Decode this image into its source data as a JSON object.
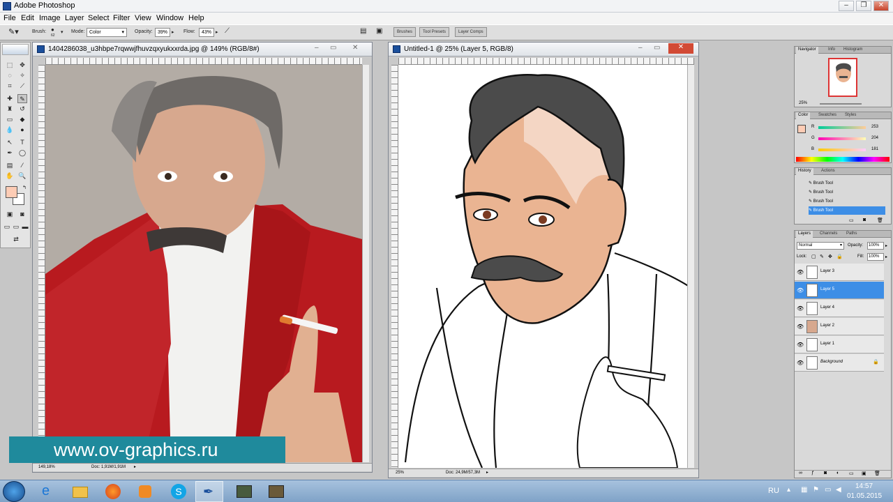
{
  "app": {
    "title": "Adobe Photoshop"
  },
  "menu": [
    "File",
    "Edit",
    "Image",
    "Layer",
    "Select",
    "Filter",
    "View",
    "Window",
    "Help"
  ],
  "options": {
    "brush_label": "Brush:",
    "brush_size": "62",
    "mode_label": "Mode:",
    "mode_value": "Color",
    "opacity_label": "Opacity:",
    "opacity_value": "39%",
    "flow_label": "Flow:",
    "flow_value": "43%",
    "well_tabs": [
      "Brushes",
      "Tool Presets",
      "Layer Comps"
    ]
  },
  "doc1": {
    "title": "1404286038_u3hbpe7rqwwjfhuvzqxyukxxrda.jpg @ 149% (RGB/8#)",
    "zoom": "149,18%",
    "doc_size": "Doc: 1,91M/1,91M"
  },
  "doc2": {
    "title": "Untitled-1 @ 25% (Layer 5, RGB/8)",
    "zoom": "25%",
    "doc_size": "Doc: 24,9M/57,3M"
  },
  "navigator": {
    "tabs": [
      "Navigator",
      "Info",
      "Histogram"
    ],
    "zoom": "25%"
  },
  "color": {
    "tabs": [
      "Color",
      "Swatches",
      "Styles"
    ],
    "channels": [
      {
        "label": "R",
        "value": "253"
      },
      {
        "label": "G",
        "value": "204"
      },
      {
        "label": "B",
        "value": "181"
      }
    ],
    "swatch": "#fdccb5"
  },
  "history": {
    "tabs": [
      "History",
      "Actions"
    ],
    "items": [
      "Brush Tool",
      "Brush Tool",
      "Brush Tool",
      "Brush Tool"
    ]
  },
  "layers": {
    "tabs": [
      "Layers",
      "Channels",
      "Paths"
    ],
    "blend_mode": "Normal",
    "opacity_label": "Opacity:",
    "opacity_value": "100%",
    "lock_label": "Lock:",
    "fill_label": "Fill:",
    "fill_value": "100%",
    "items": [
      "Layer 3",
      "Layer 5",
      "Layer 4",
      "Layer 2",
      "Layer 1",
      "Background"
    ]
  },
  "watermark": "www.ov-graphics.ru",
  "tray": {
    "lang": "RU",
    "time": "14:57",
    "date": "01.05.2015"
  }
}
